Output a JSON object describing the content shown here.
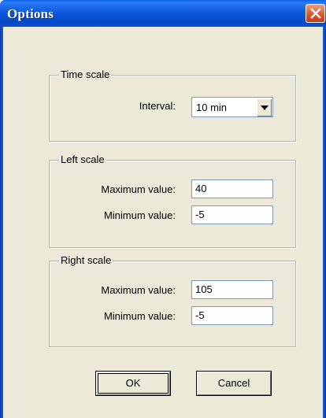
{
  "window": {
    "title": "Options"
  },
  "time_scale": {
    "label": "Time scale",
    "interval_label": "Interval:",
    "interval_value": "10 min"
  },
  "left_scale": {
    "label": "Left scale",
    "max_label": "Maximum value:",
    "max_value": "40",
    "min_label": "Minimum value:",
    "min_value": "-5"
  },
  "right_scale": {
    "label": "Right scale",
    "max_label": "Maximum value:",
    "max_value": "105",
    "min_label": "Minimum value:",
    "min_value": "-5"
  },
  "buttons": {
    "ok": "OK",
    "cancel": "Cancel"
  },
  "colors": {
    "titlebar": "#0a4fd0",
    "dialog_bg": "#ece9d8",
    "close_button": "#e2552d"
  }
}
